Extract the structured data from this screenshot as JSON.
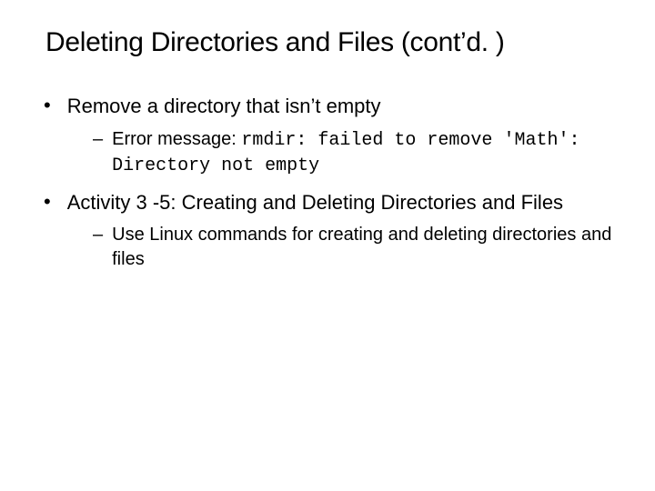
{
  "title": "Deleting Directories and Files (cont’d. )",
  "bullets": [
    {
      "text": "Remove a directory that isn’t empty",
      "sub": [
        {
          "prefix": "Error message: ",
          "code": "rmdir: failed to remove 'Math': Directory not empty"
        }
      ]
    },
    {
      "text": "Activity 3 -5: Creating and Deleting Directories and Files",
      "sub": [
        {
          "prefix": "Use Linux commands for creating and deleting directories and files",
          "code": ""
        }
      ]
    }
  ]
}
